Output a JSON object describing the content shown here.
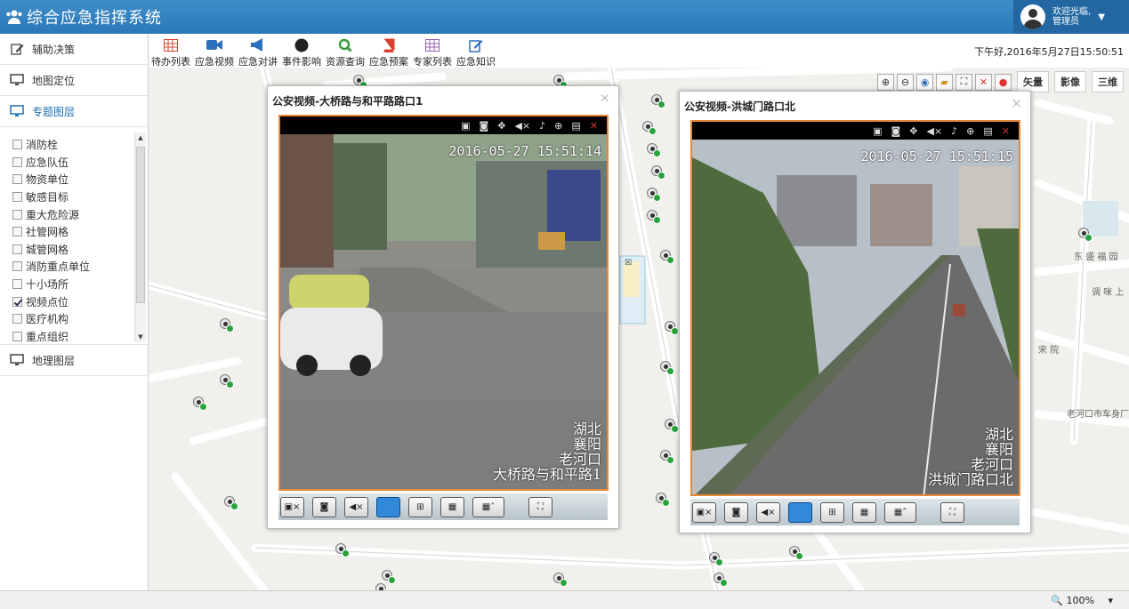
{
  "header": {
    "title": "综合应急指挥系统",
    "user_welcome": "欢迎光临,",
    "user_role": "管理员"
  },
  "sidebar": {
    "items": [
      {
        "label": "辅助决策",
        "icon": "edit-icon"
      },
      {
        "label": "地图定位",
        "icon": "monitor-icon"
      },
      {
        "label": "专题图层",
        "icon": "monitor-icon",
        "active": true
      }
    ],
    "layers": [
      {
        "label": "消防栓",
        "checked": false
      },
      {
        "label": "应急队伍",
        "checked": false
      },
      {
        "label": "物资单位",
        "checked": false
      },
      {
        "label": "敏感目标",
        "checked": false
      },
      {
        "label": "重大危险源",
        "checked": false
      },
      {
        "label": "社管网格",
        "checked": false
      },
      {
        "label": "城管网格",
        "checked": false
      },
      {
        "label": "消防重点单位",
        "checked": false
      },
      {
        "label": "十小场所",
        "checked": false
      },
      {
        "label": "视频点位",
        "checked": true
      },
      {
        "label": "医疗机构",
        "checked": false
      },
      {
        "label": "重点组织",
        "checked": false
      }
    ],
    "bottom_item": {
      "label": "地理图层"
    }
  },
  "toolbar": {
    "items": [
      {
        "label": "待办列表",
        "color": "#d9412e"
      },
      {
        "label": "应急视频",
        "color": "#2d6fba"
      },
      {
        "label": "应急对讲",
        "color": "#2d6fba"
      },
      {
        "label": "事件影响",
        "color": "#222222"
      },
      {
        "label": "资源查询",
        "color": "#3a9a3a"
      },
      {
        "label": "应急预案",
        "color": "#d9412e"
      },
      {
        "label": "专家列表",
        "color": "#9a5fb5"
      },
      {
        "label": "应急知识",
        "color": "#2d6fba"
      }
    ],
    "datetime": "下午好,2016年5月27日15:50:51"
  },
  "map": {
    "view_buttons": [
      "矢量",
      "影像",
      "三维"
    ],
    "labels": [
      "东 盛 福 园",
      "调 咪 上",
      "宋 院",
      "老河口市车身厂"
    ]
  },
  "video_windows": [
    {
      "title": "公安视频-大桥路与和平路路口1",
      "timestamp": "2016-05-27 15:51:14",
      "caption": [
        "湖北",
        "襄阳",
        "老河口",
        "大桥路与和平路1"
      ]
    },
    {
      "title": "公安视频-洪城门路口北",
      "timestamp": "2016-05-27 15:51:15",
      "caption": [
        "湖北",
        "襄阳",
        "老河口",
        "洪城门路口北"
      ]
    }
  ],
  "status": {
    "zoom": "100%"
  }
}
